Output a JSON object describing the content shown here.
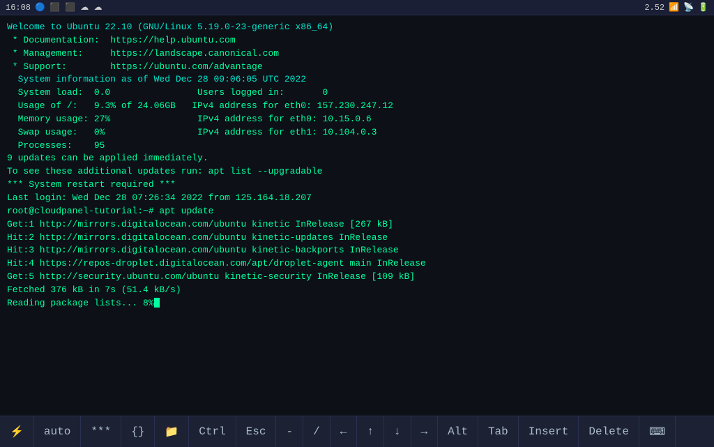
{
  "statusBar": {
    "time": "16:08",
    "icons": [
      "bluetooth",
      "unknown1",
      "unknown2",
      "unknown3",
      "unknown4"
    ],
    "rightInfo": "2.52",
    "wifi": "wifi-icon",
    "signal": "signal-icon",
    "battery": "battery-icon"
  },
  "terminal": {
    "lines": [
      {
        "text": "Welcome to Ubuntu 22.10 (GNU/Linux 5.19.0-23-generic x86_64)",
        "class": "cyan"
      },
      {
        "text": "",
        "class": "green"
      },
      {
        "text": " * Documentation:  https://help.ubuntu.com",
        "class": "green"
      },
      {
        "text": " * Management:     https://landscape.canonical.com",
        "class": "green"
      },
      {
        "text": " * Support:        https://ubuntu.com/advantage",
        "class": "green"
      },
      {
        "text": "",
        "class": "green"
      },
      {
        "text": "  System information as of Wed Dec 28 09:06:05 UTC 2022",
        "class": "cyan"
      },
      {
        "text": "",
        "class": "green"
      },
      {
        "text": "  System load:  0.0                Users logged in:       0",
        "class": "green"
      },
      {
        "text": "  Usage of /:   9.3% of 24.06GB   IPv4 address for eth0: 157.230.247.12",
        "class": "green"
      },
      {
        "text": "  Memory usage: 27%                IPv4 address for eth0: 10.15.0.6",
        "class": "green"
      },
      {
        "text": "  Swap usage:   0%                 IPv4 address for eth1: 10.104.0.3",
        "class": "green"
      },
      {
        "text": "  Processes:    95",
        "class": "green"
      },
      {
        "text": "",
        "class": "green"
      },
      {
        "text": "9 updates can be applied immediately.",
        "class": "green"
      },
      {
        "text": "To see these additional updates run: apt list --upgradable",
        "class": "green"
      },
      {
        "text": "",
        "class": "green"
      },
      {
        "text": "",
        "class": "green"
      },
      {
        "text": "*** System restart required ***",
        "class": "green"
      },
      {
        "text": "Last login: Wed Dec 28 07:26:34 2022 from 125.164.18.207",
        "class": "green"
      },
      {
        "text": "root@cloudpanel-tutorial:~# apt update",
        "class": "green"
      },
      {
        "text": "Get:1 http://mirrors.digitalocean.com/ubuntu kinetic InRelease [267 kB]",
        "class": "green"
      },
      {
        "text": "Hit:2 http://mirrors.digitalocean.com/ubuntu kinetic-updates InRelease",
        "class": "green"
      },
      {
        "text": "Hit:3 http://mirrors.digitalocean.com/ubuntu kinetic-backports InRelease",
        "class": "green"
      },
      {
        "text": "Hit:4 https://repos-droplet.digitalocean.com/apt/droplet-agent main InRelease",
        "class": "green"
      },
      {
        "text": "Get:5 http://security.ubuntu.com/ubuntu kinetic-security InRelease [109 kB]",
        "class": "green"
      },
      {
        "text": "Fetched 376 kB in 7s (51.4 kB/s)",
        "class": "green"
      },
      {
        "text": "Reading package lists... 8%",
        "class": "green",
        "cursor": true
      }
    ]
  },
  "toolbar": {
    "items": [
      {
        "icon": "⚡",
        "label": "",
        "name": "terminal-icon-item"
      },
      {
        "icon": "auto",
        "label": "",
        "name": "auto-item"
      },
      {
        "icon": "***",
        "label": "",
        "name": "asterisk-item"
      },
      {
        "icon": "{}",
        "label": "",
        "name": "braces-item"
      },
      {
        "icon": "📁",
        "label": "",
        "name": "folder-item"
      },
      {
        "icon": "Ctrl",
        "label": "",
        "name": "ctrl-item"
      },
      {
        "icon": "Esc",
        "label": "",
        "name": "esc-item"
      },
      {
        "icon": "-",
        "label": "",
        "name": "dash-item"
      },
      {
        "icon": "/",
        "label": "",
        "name": "slash-item"
      },
      {
        "icon": "←",
        "label": "",
        "name": "left-arrow-item"
      },
      {
        "icon": "↑",
        "label": "",
        "name": "up-arrow-item"
      },
      {
        "icon": "↓",
        "label": "",
        "name": "down-arrow-item"
      },
      {
        "icon": "→",
        "label": "",
        "name": "right-arrow-item"
      },
      {
        "icon": "Alt",
        "label": "",
        "name": "alt-item"
      },
      {
        "icon": "Tab",
        "label": "",
        "name": "tab-item"
      },
      {
        "icon": "Insert",
        "label": "",
        "name": "insert-item"
      },
      {
        "icon": "Delete",
        "label": "",
        "name": "delete-item"
      },
      {
        "icon": "⌨",
        "label": "",
        "name": "keyboard-item"
      }
    ]
  }
}
